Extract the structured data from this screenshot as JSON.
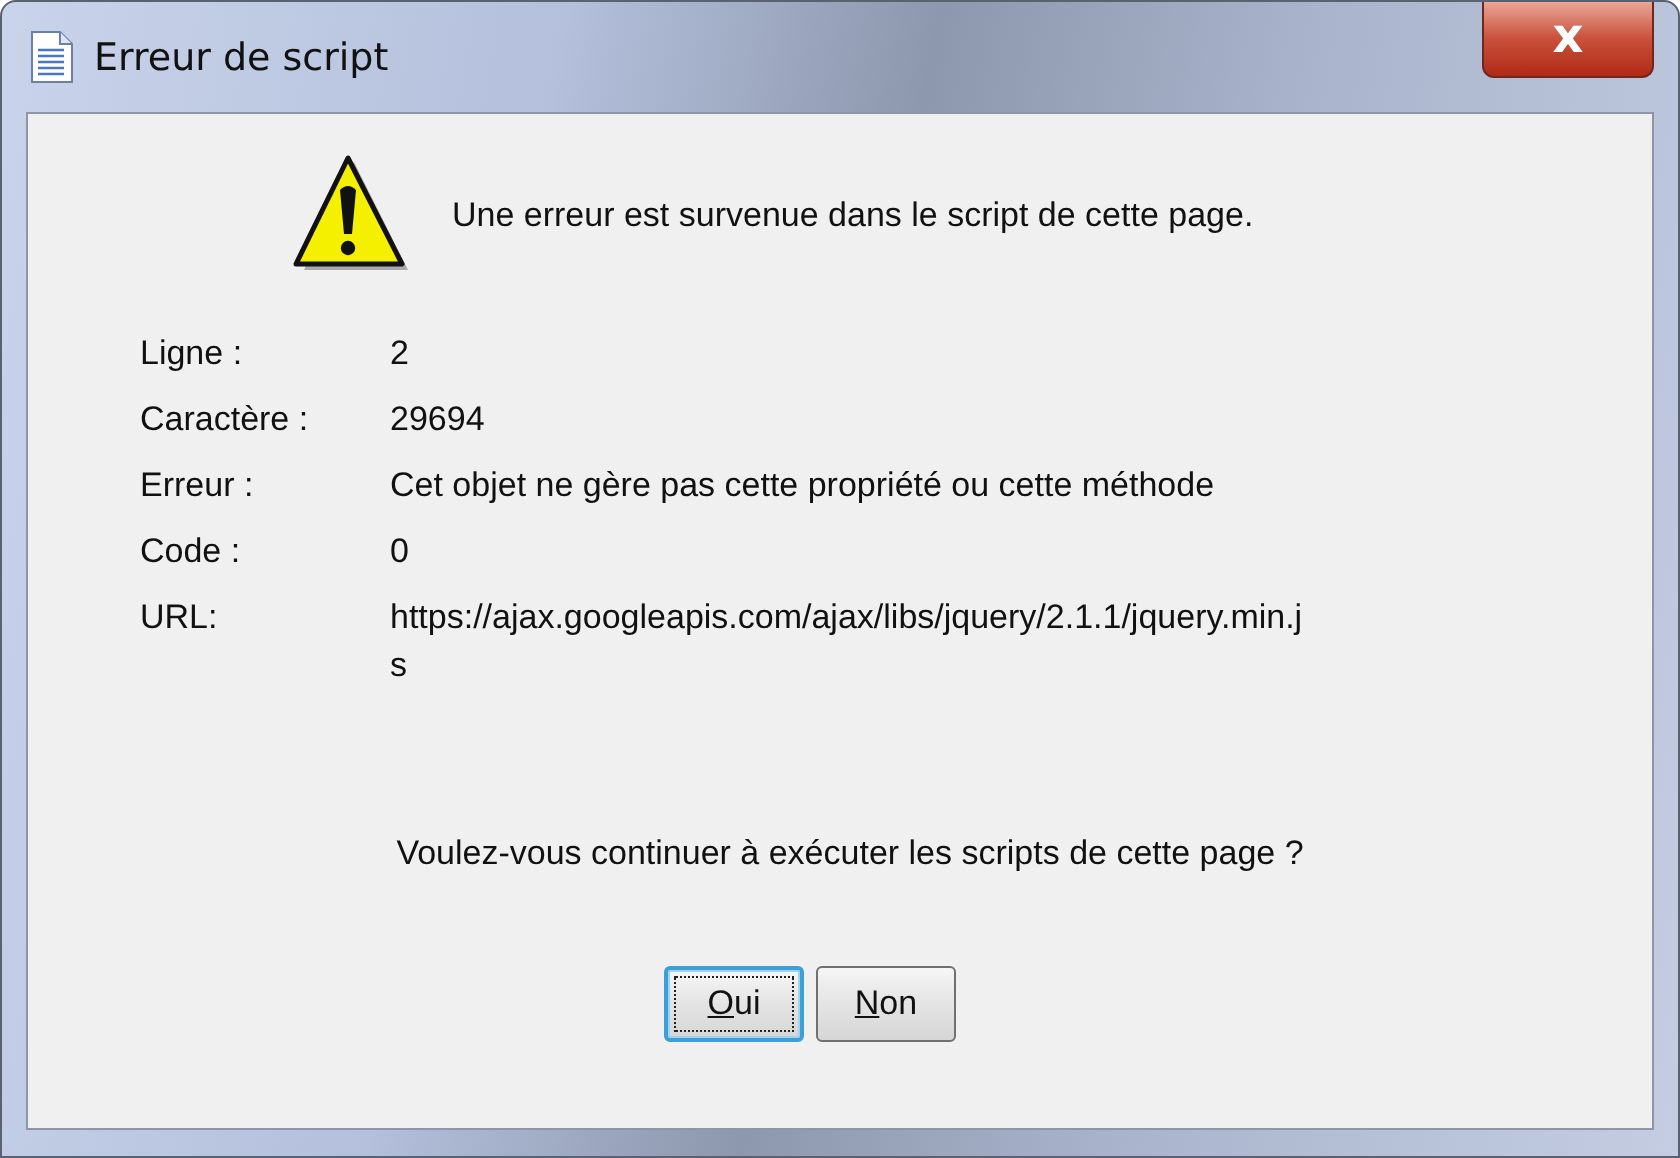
{
  "window": {
    "title": "Erreur de script",
    "close": "x"
  },
  "message": "Une erreur est survenue dans le script de cette page.",
  "details": [
    {
      "label": "Ligne :",
      "value": "2"
    },
    {
      "label": "Caractère :",
      "value": "29694"
    },
    {
      "label": "Erreur :",
      "value": "Cet objet ne gère pas cette propriété ou cette méthode"
    },
    {
      "label": "Code :",
      "value": "0"
    },
    {
      "label": "URL:",
      "value": "https://ajax.googleapis.com/ajax/libs/jquery/2.1.1/jquery.min.js"
    }
  ],
  "question": "Voulez-vous continuer à exécuter les scripts de cette page ?",
  "buttons": [
    {
      "label": "Oui",
      "default": true
    },
    {
      "label": "Non",
      "default": false
    }
  ]
}
